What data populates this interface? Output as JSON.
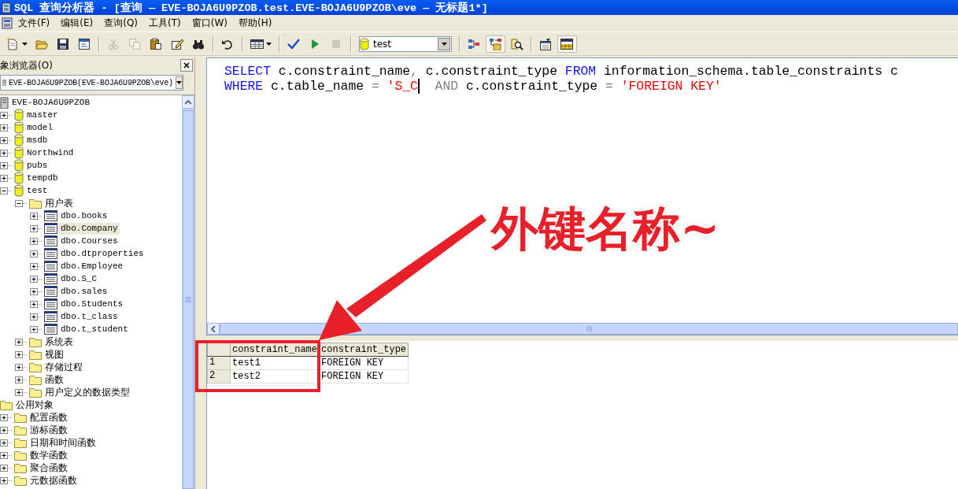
{
  "window": {
    "title": "SQL 查询分析器 - [查询 — EVE-BOJA6U9PZOB.test.EVE-BOJA6U9PZOB\\eve — 无标题1*]"
  },
  "menu": [
    "文件(F)",
    "编辑(E)",
    "查询(Q)",
    "工具(T)",
    "窗口(W)",
    "帮助(H)"
  ],
  "toolbar": [
    {
      "kind": "new",
      "disabled": false,
      "pressed": false,
      "dropdown": true
    },
    {
      "kind": "open",
      "disabled": false,
      "pressed": false,
      "dropdown": false
    },
    {
      "kind": "save",
      "disabled": false,
      "pressed": false,
      "dropdown": false
    },
    {
      "kind": "script",
      "disabled": false,
      "pressed": false,
      "dropdown": false
    },
    {
      "kind": "separator"
    },
    {
      "kind": "cut",
      "disabled": true,
      "pressed": false,
      "dropdown": false
    },
    {
      "kind": "copy",
      "disabled": true,
      "pressed": false,
      "dropdown": false
    },
    {
      "kind": "paste",
      "disabled": false,
      "pressed": false,
      "dropdown": false
    },
    {
      "kind": "edit",
      "disabled": false,
      "pressed": false,
      "dropdown": false
    },
    {
      "kind": "find",
      "disabled": false,
      "pressed": false,
      "dropdown": false
    },
    {
      "kind": "separator"
    },
    {
      "kind": "undo",
      "disabled": false,
      "pressed": false,
      "dropdown": false
    },
    {
      "kind": "separator"
    },
    {
      "kind": "grid",
      "disabled": false,
      "pressed": false,
      "dropdown": true
    },
    {
      "kind": "separator"
    },
    {
      "kind": "check",
      "disabled": false,
      "pressed": false,
      "dropdown": false
    },
    {
      "kind": "run",
      "disabled": false,
      "pressed": false,
      "dropdown": false
    },
    {
      "kind": "stop",
      "disabled": true,
      "pressed": false,
      "dropdown": false
    },
    {
      "kind": "separator"
    },
    {
      "kind": "database-select",
      "value": "test"
    },
    {
      "kind": "separator"
    },
    {
      "kind": "plan",
      "disabled": false,
      "pressed": false,
      "dropdown": false
    },
    {
      "kind": "browser",
      "disabled": false,
      "pressed": true,
      "dropdown": false
    },
    {
      "kind": "search",
      "disabled": false,
      "pressed": false,
      "dropdown": false
    },
    {
      "kind": "separator"
    },
    {
      "kind": "properties",
      "disabled": false,
      "pressed": false,
      "dropdown": false
    },
    {
      "kind": "results",
      "disabled": false,
      "pressed": true,
      "dropdown": false
    }
  ],
  "object_browser": {
    "title": "象浏览器(O)",
    "server_select": "EVE-BOJA6U9PZOB(EVE-BOJA6U9PZOB\\eve)",
    "tree": [
      {
        "label": "EVE-BOJA6U9PZOB",
        "kind": "server",
        "selected": false,
        "children": [
          {
            "label": "master",
            "kind": "database",
            "expanded": false,
            "selected": false
          },
          {
            "label": "model",
            "kind": "database",
            "expanded": false,
            "selected": false
          },
          {
            "label": "msdb",
            "kind": "database",
            "expanded": false,
            "selected": false
          },
          {
            "label": "Northwind",
            "kind": "database",
            "expanded": false,
            "selected": false
          },
          {
            "label": "pubs",
            "kind": "database",
            "expanded": false,
            "selected": false
          },
          {
            "label": "tempdb",
            "kind": "database",
            "expanded": false,
            "selected": false
          },
          {
            "label": "test",
            "kind": "database",
            "expanded": true,
            "selected": false,
            "children": [
              {
                "label": "用户表",
                "kind": "folder",
                "expanded": true,
                "selected": false,
                "children": [
                  {
                    "label": "dbo.books",
                    "kind": "table",
                    "expanded": false,
                    "selected": false
                  },
                  {
                    "label": "dbo.Company",
                    "kind": "table",
                    "expanded": false,
                    "selected": true
                  },
                  {
                    "label": "dbo.Courses",
                    "kind": "table",
                    "expanded": false,
                    "selected": false
                  },
                  {
                    "label": "dbo.dtproperties",
                    "kind": "table",
                    "expanded": false,
                    "selected": false
                  },
                  {
                    "label": "dbo.Employee",
                    "kind": "table",
                    "expanded": false,
                    "selected": false
                  },
                  {
                    "label": "dbo.S_C",
                    "kind": "table",
                    "expanded": false,
                    "selected": false
                  },
                  {
                    "label": "dbo.sales",
                    "kind": "table",
                    "expanded": false,
                    "selected": false
                  },
                  {
                    "label": "dbo.Students",
                    "kind": "table",
                    "expanded": false,
                    "selected": false
                  },
                  {
                    "label": "dbo.t_class",
                    "kind": "table",
                    "expanded": false,
                    "selected": false
                  },
                  {
                    "label": "dbo.t_student",
                    "kind": "table",
                    "expanded": false,
                    "selected": false
                  }
                ]
              },
              {
                "label": "系统表",
                "kind": "folder",
                "expanded": false,
                "selected": false
              },
              {
                "label": "视图",
                "kind": "folder",
                "expanded": false,
                "selected": false
              },
              {
                "label": "存储过程",
                "kind": "folder",
                "expanded": false,
                "selected": false
              },
              {
                "label": "函数",
                "kind": "folder",
                "expanded": false,
                "selected": false
              },
              {
                "label": "用户定义的数据类型",
                "kind": "folder",
                "expanded": false,
                "selected": false
              }
            ]
          }
        ]
      },
      {
        "label": "公用对象",
        "kind": "folder",
        "selected": false,
        "children": [
          {
            "label": "配置函数",
            "kind": "folder",
            "expanded": false,
            "selected": false
          },
          {
            "label": "游标函数",
            "kind": "folder",
            "expanded": false,
            "selected": false
          },
          {
            "label": "日期和时间函数",
            "kind": "folder",
            "expanded": false,
            "selected": false
          },
          {
            "label": "数学函数",
            "kind": "folder",
            "expanded": false,
            "selected": false
          },
          {
            "label": "聚合函数",
            "kind": "folder",
            "expanded": false,
            "selected": false
          },
          {
            "label": "元数据函数",
            "kind": "folder",
            "expanded": false,
            "selected": false
          }
        ]
      }
    ]
  },
  "editor": {
    "lines": [
      [
        {
          "kind": "keyword",
          "text": "SELECT",
          "caret": false
        },
        {
          "kind": "plain",
          "text": " c.constraint_name",
          "caret": false
        },
        {
          "kind": "operator",
          "text": ",",
          "caret": false
        },
        {
          "kind": "plain",
          "text": " c.constraint_type ",
          "caret": false
        },
        {
          "kind": "keyword",
          "text": "FROM",
          "caret": false
        },
        {
          "kind": "plain",
          "text": " information_schema.table_constraints c",
          "caret": false
        }
      ],
      [
        {
          "kind": "keyword",
          "text": "WHERE",
          "caret": false
        },
        {
          "kind": "plain",
          "text": " c.table_name ",
          "caret": false
        },
        {
          "kind": "operator",
          "text": "=",
          "caret": false
        },
        {
          "kind": "string",
          "text": " 'S_C",
          "caret": true
        },
        {
          "kind": "operator",
          "text": "  AND",
          "caret": false
        },
        {
          "kind": "plain",
          "text": " c.constraint_type ",
          "caret": false
        },
        {
          "kind": "operator",
          "text": "=",
          "caret": false
        },
        {
          "kind": "string",
          "text": " 'FOREIGN KEY'",
          "caret": false
        }
      ]
    ]
  },
  "results": {
    "columns": [
      "constraint_name",
      "constraint_type"
    ],
    "rows": [
      {
        "number": "1",
        "cells": [
          "test1",
          "FOREIGN KEY"
        ]
      },
      {
        "number": "2",
        "cells": [
          "test2",
          "FOREIGN KEY"
        ]
      }
    ]
  },
  "annotation": {
    "label": "外键名称~"
  }
}
